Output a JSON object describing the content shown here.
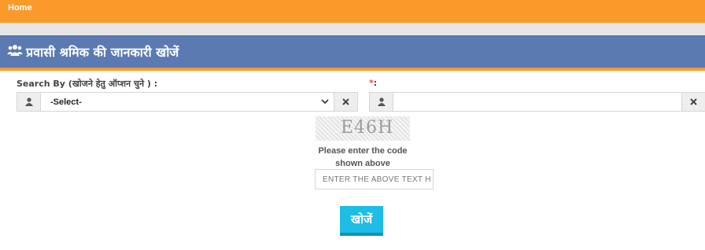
{
  "nav": {
    "home_label": "Home"
  },
  "header": {
    "icon": "users-icon",
    "title": "प्रवासी श्रमिक की जानकारी खोजें"
  },
  "form": {
    "search_by_label": "Search By (खोजने हेतु ऑप्शन चुने ) :",
    "search_by_value": "-Select-",
    "second_label_marker": "*",
    "second_label_suffix": ":",
    "second_value": ""
  },
  "captcha": {
    "image_text": "E46H",
    "hint_line1": "Please enter the code",
    "hint_line2": "shown above",
    "placeholder": "ENTER THE ABOVE TEXT H"
  },
  "actions": {
    "search_label": "खोजें"
  },
  "colors": {
    "orange": "#f99a2b",
    "blue": "#5b7ab2",
    "button": "#1ebde6"
  }
}
